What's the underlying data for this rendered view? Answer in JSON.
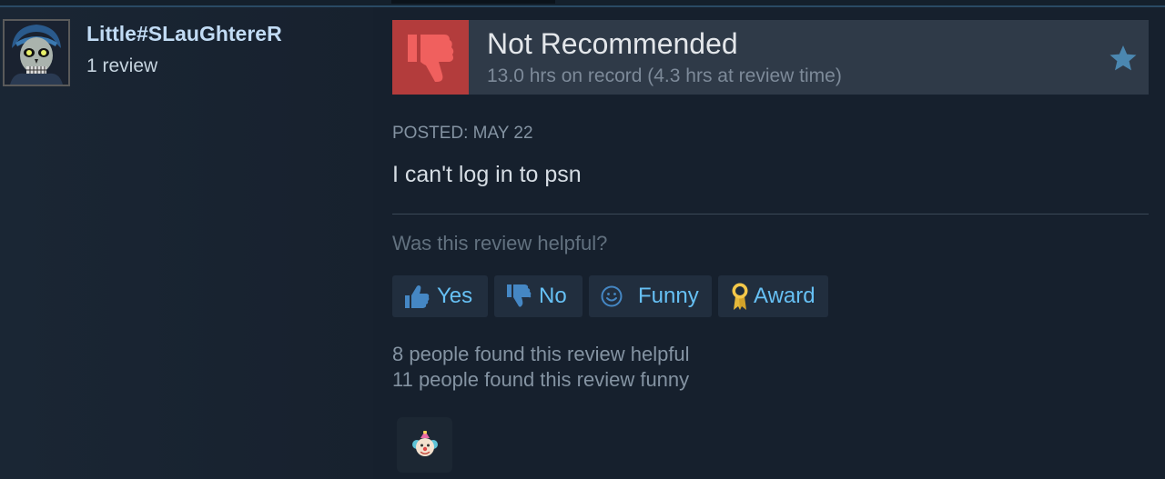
{
  "user": {
    "name": "Little#SLauGhtereR",
    "review_count": "1 review"
  },
  "review": {
    "verdict": "Not Recommended",
    "hours": "13.0 hrs on record (4.3 hrs at review time)",
    "posted": "POSTED: MAY 22",
    "text": "I can't log in to psn"
  },
  "helpful": {
    "question": "Was this review helpful?",
    "buttons": {
      "yes": "Yes",
      "no": "No",
      "funny": "Funny",
      "award": "Award"
    },
    "stats": {
      "helpful": "8 people found this review helpful",
      "funny": "11 people found this review funny"
    }
  },
  "icons": {
    "verdict_icon": "thumbs-down-icon",
    "favorite_icon": "star-icon",
    "yes_icon": "thumbs-up-icon",
    "no_icon": "thumbs-down-icon",
    "funny_icon": "smiley-icon",
    "award_icon": "ribbon-medal-icon",
    "received_award_icon": "clown-face-icon"
  },
  "colors": {
    "background": "#1b2838",
    "negative_verdict": "#b33c3c",
    "link_blue": "#66c0f4",
    "username": "#c1dbf4"
  }
}
